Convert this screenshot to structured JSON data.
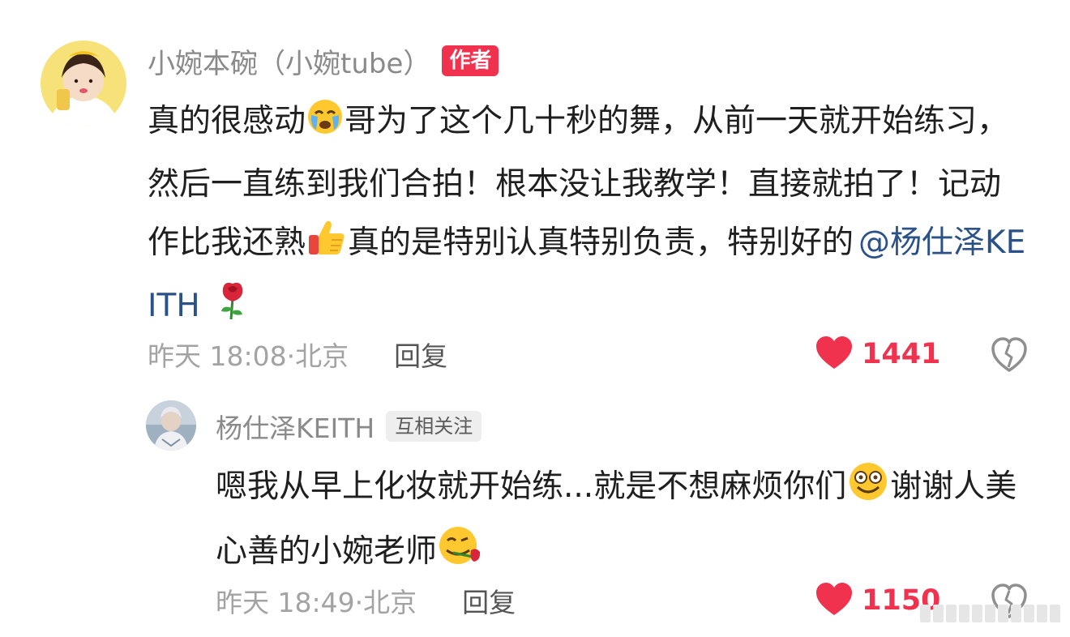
{
  "comments": [
    {
      "author": "小婉本碗（小婉tube）",
      "badge": "作者",
      "text_part1": "真的很感动",
      "emoji1": "crying-emoji",
      "text_part2": "哥为了这个几十秒的舞，从前一天就开始练习，然后一直练到我们合拍！根本没让我教学！直接就拍了！记动作比我还熟",
      "emoji2": "thumbs-up-emoji",
      "text_part3": "真的是特别认真特别负责，特别好的",
      "mention": "@杨仕泽KEITH",
      "emoji3": "rose-emoji",
      "time": "昨天 18:08·北京",
      "reply_label": "回复",
      "likes": "1441"
    },
    {
      "author": "杨仕泽KEITH",
      "badge": "互相关注",
      "text_part1": "嗯我从早上化妆就开始练...就是不想麻烦你们",
      "emoji1": "grinning-emoji",
      "text_part2": "谢谢人美心善的小婉老师",
      "emoji2": "rose-mouth-emoji",
      "time": "昨天 18:49·北京",
      "reply_label": "回复",
      "likes": "1150"
    }
  ],
  "colors": {
    "accent": "#f0324f",
    "mention": "#2a5188",
    "meta": "#a3a3a3",
    "name": "#8a8a8a"
  }
}
